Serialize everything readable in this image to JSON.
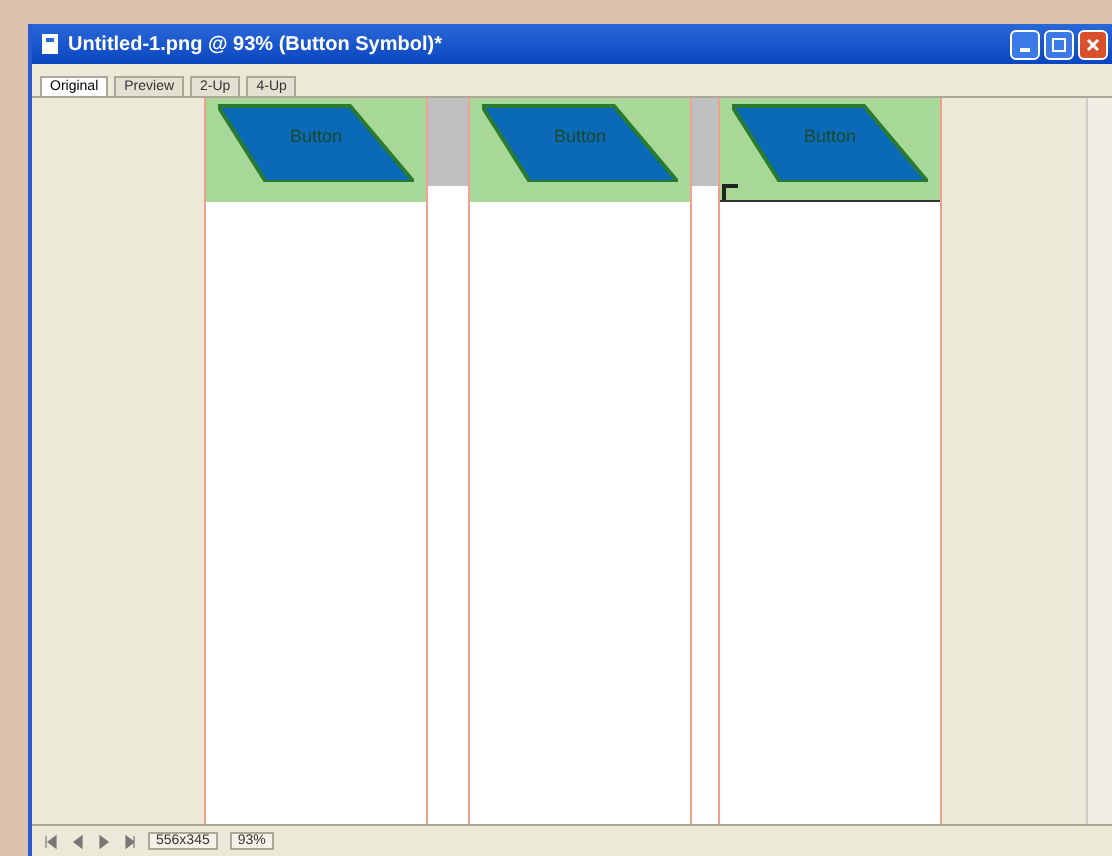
{
  "window": {
    "title": "Untitled-1.png @ 93% (Button Symbol)*"
  },
  "tabs": [
    {
      "label": "Original",
      "selected": true
    },
    {
      "label": "Preview",
      "selected": false
    },
    {
      "label": "2-Up",
      "selected": false
    },
    {
      "label": "4-Up",
      "selected": false
    }
  ],
  "slices": [
    {
      "label": "Button",
      "selected": false
    },
    {
      "label": "Button",
      "selected": false
    },
    {
      "label": "Button",
      "selected": true
    }
  ],
  "status_bar": {
    "size": "556x345",
    "zoom": "93%"
  }
}
